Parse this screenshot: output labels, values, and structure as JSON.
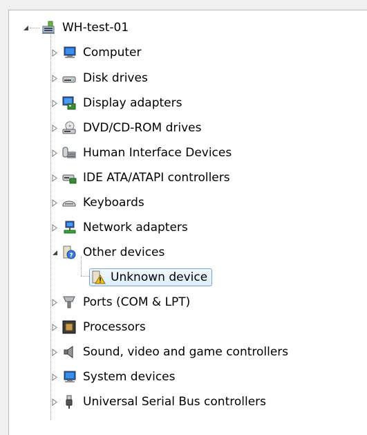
{
  "root": {
    "label": "WH-test-01",
    "icon": "computer-root-icon"
  },
  "categories": [
    {
      "label": "Computer",
      "icon": "computer-icon",
      "expanded": false
    },
    {
      "label": "Disk drives",
      "icon": "disk-drive-icon",
      "expanded": false
    },
    {
      "label": "Display adapters",
      "icon": "display-adapter-icon",
      "expanded": false
    },
    {
      "label": "DVD/CD-ROM drives",
      "icon": "dvd-drive-icon",
      "expanded": false
    },
    {
      "label": "Human Interface Devices",
      "icon": "hid-icon",
      "expanded": false
    },
    {
      "label": "IDE ATA/ATAPI controllers",
      "icon": "ide-controller-icon",
      "expanded": false
    },
    {
      "label": "Keyboards",
      "icon": "keyboard-icon",
      "expanded": false
    },
    {
      "label": "Network adapters",
      "icon": "network-adapter-icon",
      "expanded": false
    },
    {
      "label": "Other devices",
      "icon": "other-devices-icon",
      "expanded": true,
      "children": [
        {
          "label": "Unknown device",
          "icon": "unknown-device-warning-icon",
          "selected": true
        }
      ]
    },
    {
      "label": "Ports (COM & LPT)",
      "icon": "port-icon",
      "expanded": false
    },
    {
      "label": "Processors",
      "icon": "processor-icon",
      "expanded": false
    },
    {
      "label": "Sound, video and game controllers",
      "icon": "speaker-icon",
      "expanded": false
    },
    {
      "label": "System devices",
      "icon": "system-devices-icon",
      "expanded": false
    },
    {
      "label": "Universal Serial Bus controllers",
      "icon": "usb-icon",
      "expanded": false
    }
  ],
  "colors": {
    "selection_border": "#7da2ce",
    "warning": "#f0c020"
  }
}
